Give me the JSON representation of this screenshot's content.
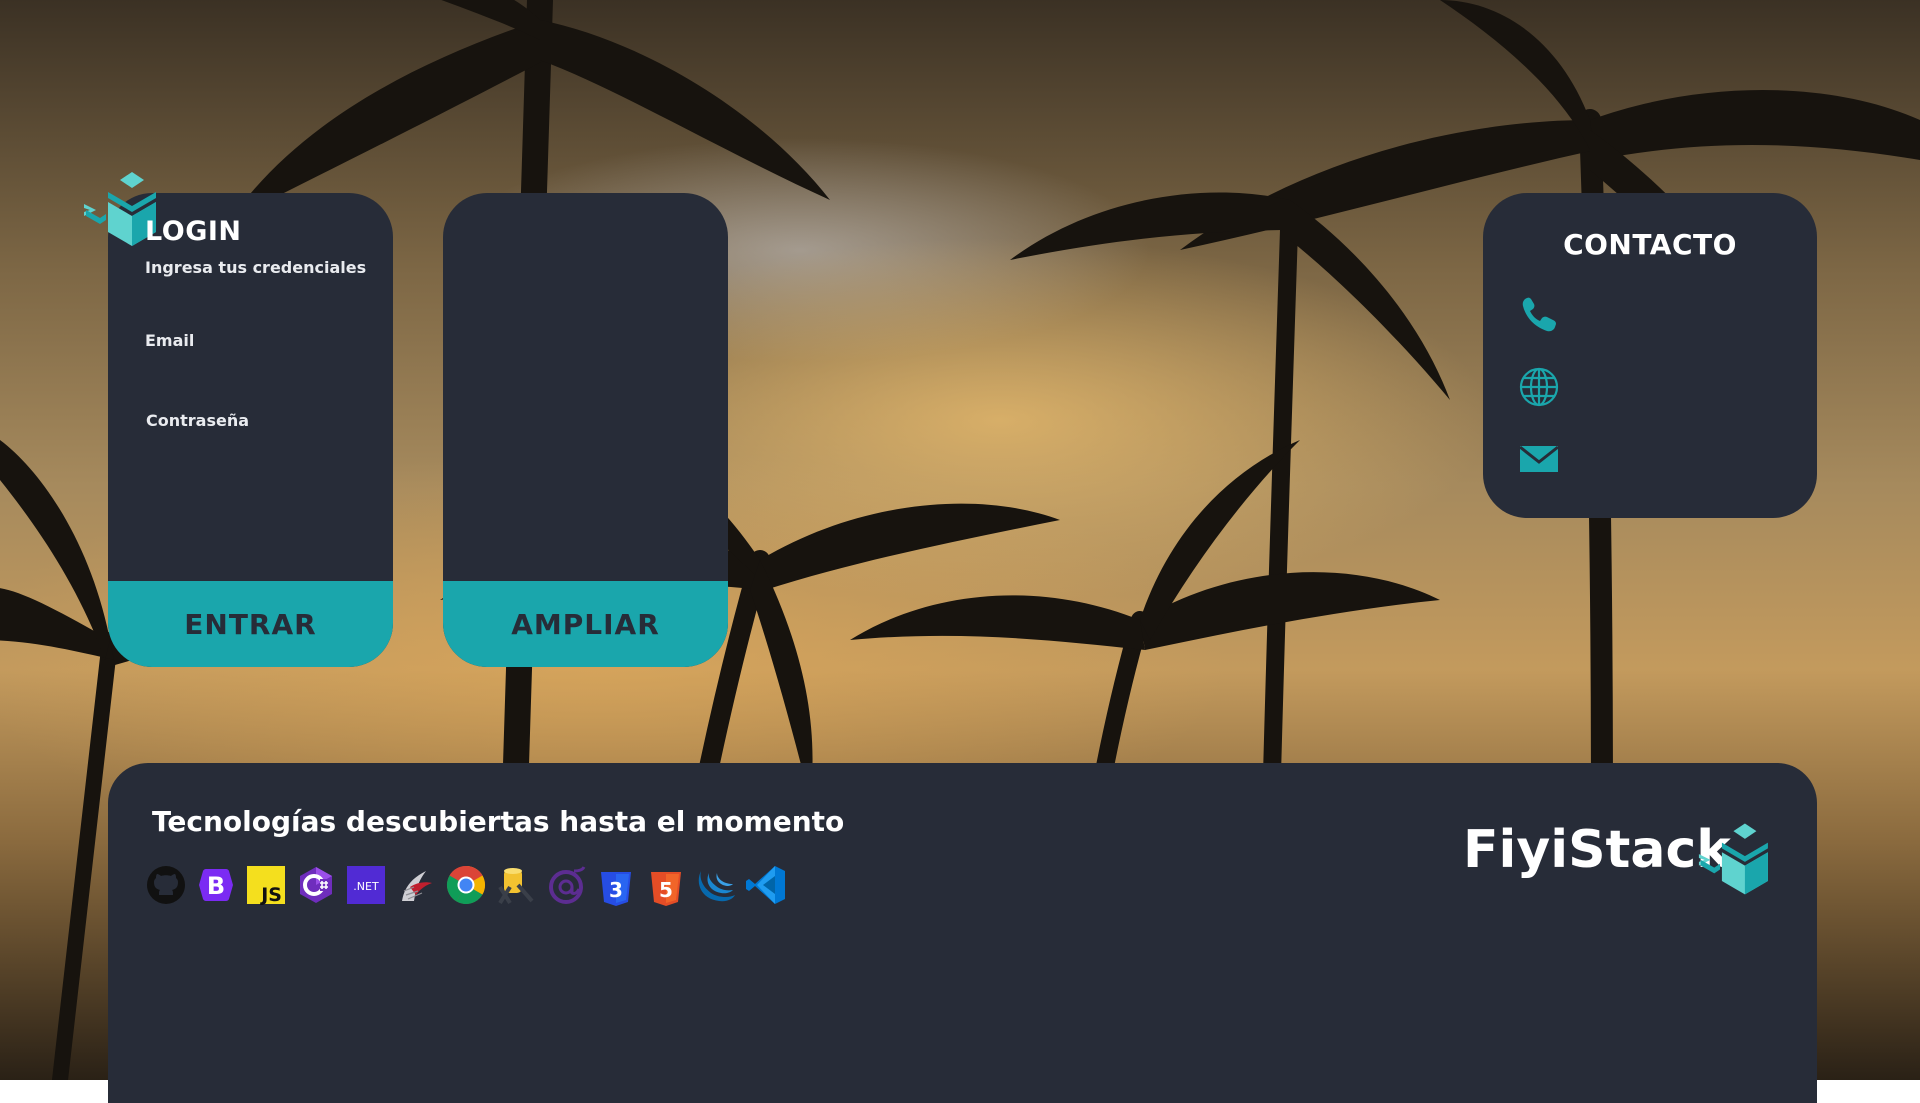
{
  "login": {
    "title": "LOGIN",
    "subtitle": "Ingresa tus credenciales",
    "email_label": "Email",
    "password_label": "Contraseña",
    "submit_label": "ENTRAR"
  },
  "ampliar": {
    "action_label": "AMPLIAR"
  },
  "contact": {
    "title": "CONTACTO",
    "items": [
      {
        "icon": "phone-icon"
      },
      {
        "icon": "globe-icon"
      },
      {
        "icon": "mail-icon"
      }
    ]
  },
  "technologies": {
    "title": "Tecnologías descubiertas hasta el momento",
    "icons": [
      "github-icon",
      "bootstrap-icon",
      "javascript-icon",
      "csharp-icon",
      "dotnet-icon",
      "sql-server-icon",
      "chrome-icon",
      "database-tool-icon",
      "blazor-icon",
      "css3-icon",
      "html5-icon",
      "jquery-icon",
      "vscode-icon"
    ],
    "icon_labels": {
      "bootstrap": "B",
      "javascript": "JS",
      "dotnet": ".NET",
      "css3": "3",
      "html5": "5"
    }
  },
  "brand": {
    "name": "FiyiStack"
  },
  "colors": {
    "panel": "#272c38",
    "accent": "#1aa6ac",
    "logo_light": "#5fd3cf",
    "logo_dark": "#1aa6ac"
  }
}
